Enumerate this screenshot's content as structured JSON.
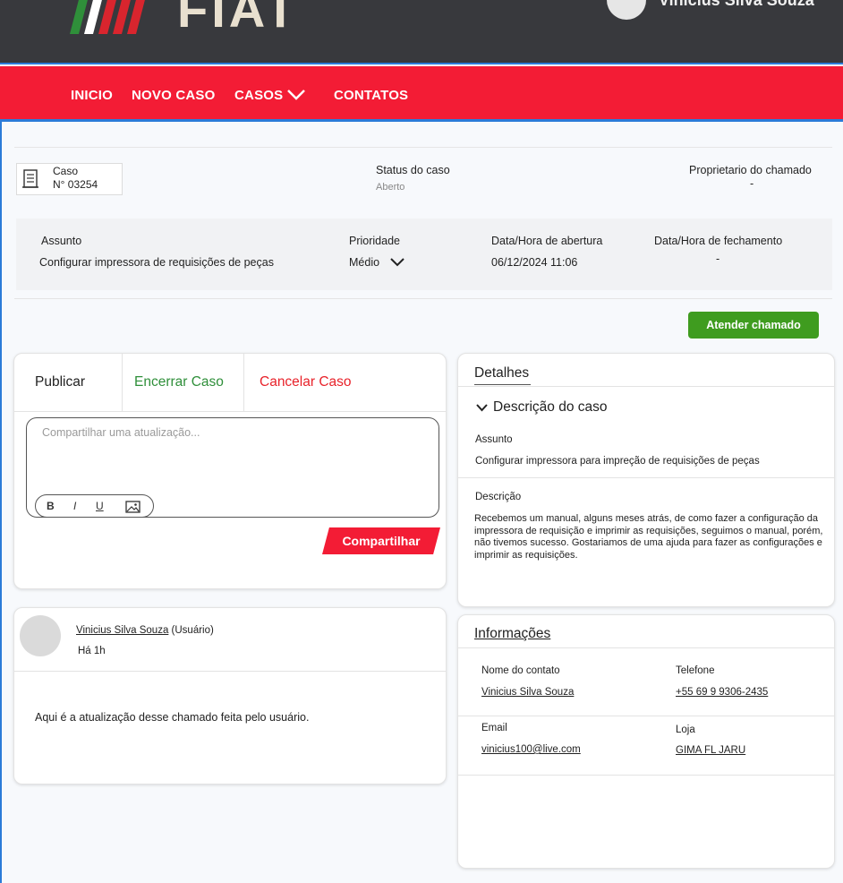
{
  "header": {
    "logo_text": "FIAT",
    "user_name": "Vinicius Silva Souza"
  },
  "nav": {
    "items": [
      "INICIO",
      "NOVO CASO",
      "CASOS",
      "CONTATOS"
    ]
  },
  "case": {
    "label": "Caso",
    "number": "N° 03254",
    "status_label": "Status do caso",
    "status_value": "Aberto",
    "owner_label": "Proprietario do chamado",
    "owner_value": "-"
  },
  "info": {
    "subject_label": "Assunto",
    "subject_value": "Configurar impressora de requisições de peças",
    "priority_label": "Prioridade",
    "priority_value": "Médio",
    "open_label": "Data/Hora de abertura",
    "open_value": "06/12/2024 11:06",
    "close_label": "Data/Hora de fechamento",
    "close_value": "-"
  },
  "actions": {
    "attend_button": "Atender chamado"
  },
  "publish": {
    "tabs": [
      "Publicar",
      "Encerrar Caso",
      "Cancelar Caso"
    ],
    "placeholder": "Compartilhar uma atualização...",
    "format_buttons": [
      "B",
      "I",
      "U"
    ],
    "share_button": "Compartilhar"
  },
  "post": {
    "author": "Vinicius Silva Souza",
    "role": "(Usuário)",
    "time": "Há 1h",
    "body": "Aqui é a atualização desse chamado feita pelo usuário."
  },
  "details": {
    "title": "Detalhes",
    "section": "Descrição do caso",
    "subject_label": "Assunto",
    "subject_value": "Configurar impressora para impreção de requisições de peças",
    "desc_label": "Descrição",
    "desc_value": "Recebemos um manual, alguns meses atrás, de como fazer a configuração da impressora de requisição e imprimir as requisições, seguimos o manual, porém, não tivemos sucesso. Gostariamos de uma ajuda para fazer as configurações e imprimir as requisições."
  },
  "informacoes": {
    "title": "Informações",
    "contact_label": "Nome do contato",
    "contact_value": "Vinicius Silva Souza",
    "phone_label": "Telefone",
    "phone_value": "+55 69 9 9306-2435",
    "email_label": "Email",
    "email_value": "vinicius100@live.com",
    "store_label": "Loja",
    "store_value": "GIMA FL JARU"
  },
  "colors": {
    "nav_red": "#f31c35",
    "header_dark": "#38393d",
    "green_button": "#3f9c1f",
    "accent_blue": "#2b7bd8"
  }
}
